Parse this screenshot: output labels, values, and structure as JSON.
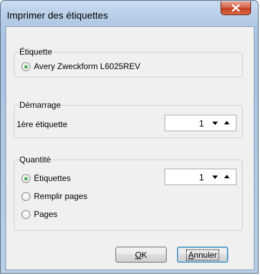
{
  "window": {
    "title": "Imprimer des étiquettes",
    "close_glyph": "x"
  },
  "label_group": {
    "legend": "Étiquette",
    "option": "Avery Zweckform L6025REV",
    "option_checked": true
  },
  "start_group": {
    "legend": "Démarrage",
    "field_label": "1ère étiquette",
    "value": "1"
  },
  "quantity_group": {
    "legend": "Quantité",
    "options": [
      {
        "label": "Étiquettes",
        "checked": true
      },
      {
        "label": "Remplir pages",
        "checked": false
      },
      {
        "label": "Pages",
        "checked": false
      }
    ],
    "value": "1"
  },
  "buttons": {
    "ok": {
      "mnemonic": "O",
      "rest": "K"
    },
    "cancel": {
      "mnemonic": "A",
      "rest": "nnuler"
    }
  }
}
